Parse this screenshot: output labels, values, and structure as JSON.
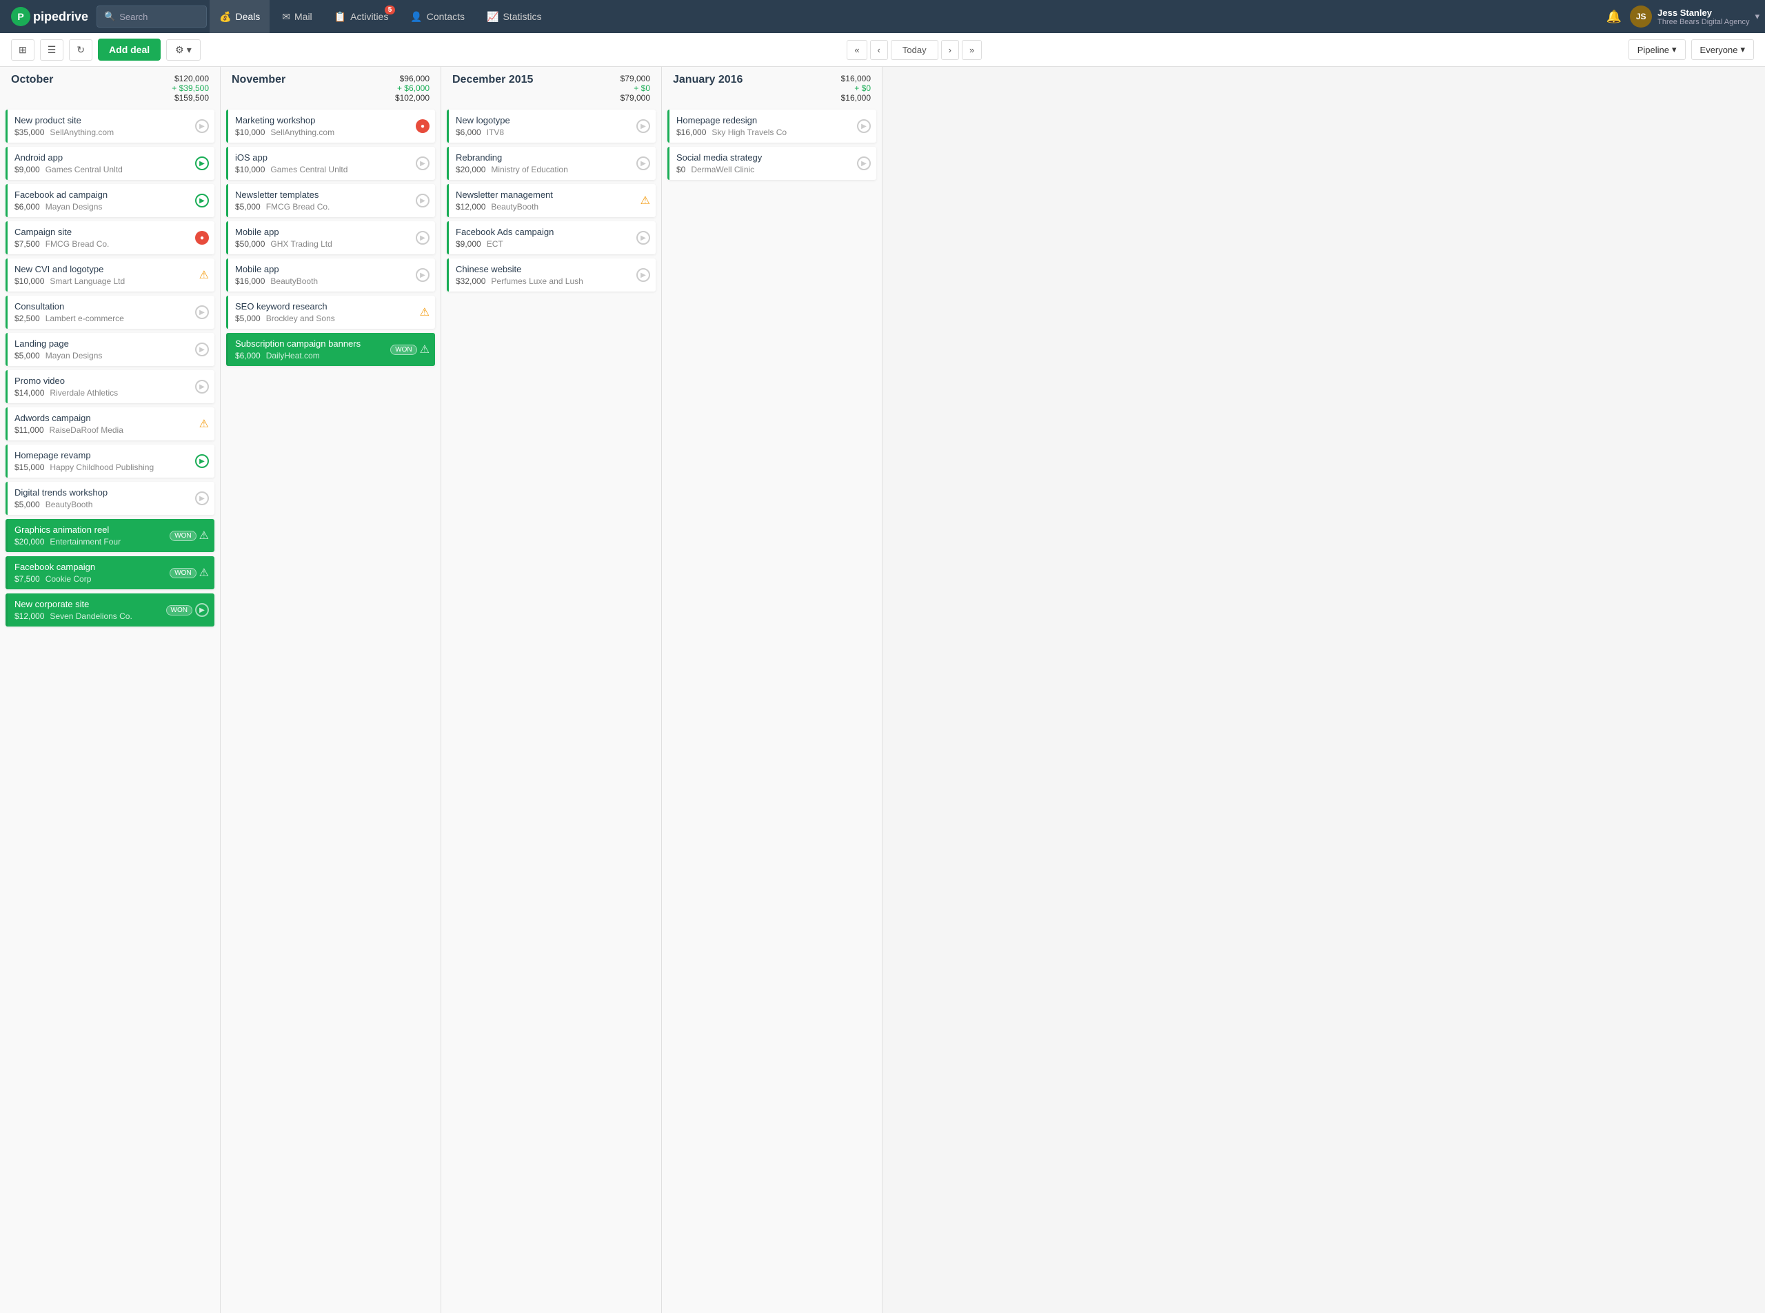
{
  "app": {
    "logo_text": "pipedrive"
  },
  "nav": {
    "search_placeholder": "Search",
    "items": [
      {
        "label": "Deals",
        "icon": "$",
        "active": true
      },
      {
        "label": "Mail",
        "icon": "✉"
      },
      {
        "label": "Activities",
        "icon": "📋",
        "badge": "5"
      },
      {
        "label": "Contacts",
        "icon": "👤"
      },
      {
        "label": "Statistics",
        "icon": "📈"
      }
    ],
    "bell_icon": "🔔",
    "user": {
      "name": "Jess Stanley",
      "company": "Three Bears Digital Agency",
      "avatar_initials": "JS"
    }
  },
  "toolbar": {
    "view_kanban": "⊞",
    "view_list": "☰",
    "refresh": "↻",
    "add_deal": "Add deal",
    "gear": "⚙",
    "arrow_first": "«",
    "arrow_prev": "‹",
    "today": "Today",
    "arrow_next": "›",
    "arrow_last": "»",
    "pipeline": "Pipeline",
    "everyone": "Everyone"
  },
  "columns": [
    {
      "id": "october",
      "title": "October",
      "amount_main": "$120,000",
      "amount_green": "+ $39,500",
      "amount_total": "$159,500",
      "deals": [
        {
          "title": "New product site",
          "amount": "$35,000",
          "org": "SellAnything.com",
          "icon": "gray-arrow"
        },
        {
          "title": "Android app",
          "amount": "$9,000",
          "org": "Games Central Unltd",
          "icon": "green-arrow"
        },
        {
          "title": "Facebook ad campaign",
          "amount": "$6,000",
          "org": "Mayan Designs",
          "icon": "green-arrow"
        },
        {
          "title": "Campaign site",
          "amount": "$7,500",
          "org": "FMCG Bread Co.",
          "icon": "red-circle"
        },
        {
          "title": "New CVI and logotype",
          "amount": "$10,000",
          "org": "Smart Language Ltd",
          "icon": "warn"
        },
        {
          "title": "Consultation",
          "amount": "$2,500",
          "org": "Lambert e-commerce",
          "icon": "gray-arrow"
        },
        {
          "title": "Landing page",
          "amount": "$5,000",
          "org": "Mayan Designs",
          "icon": "gray-arrow"
        },
        {
          "title": "Promo video",
          "amount": "$14,000",
          "org": "Riverdale Athletics",
          "icon": "gray-arrow"
        },
        {
          "title": "Adwords campaign",
          "amount": "$11,000",
          "org": "RaiseDaRoof Media",
          "icon": "warn"
        },
        {
          "title": "Homepage revamp",
          "amount": "$15,000",
          "org": "Happy Childhood Publishing",
          "icon": "green-arrow"
        },
        {
          "title": "Digital trends workshop",
          "amount": "$5,000",
          "org": "BeautyBooth",
          "icon": "gray-arrow"
        },
        {
          "title": "Graphics animation reel",
          "amount": "$20,000",
          "org": "Entertainment Four",
          "icon": "won-warn",
          "won": true
        },
        {
          "title": "Facebook campaign",
          "amount": "$7,500",
          "org": "Cookie Corp",
          "icon": "won-warn",
          "won": true
        },
        {
          "title": "New corporate site",
          "amount": "$12,000",
          "org": "Seven Dandelions Co.",
          "icon": "won-green",
          "won": true
        }
      ]
    },
    {
      "id": "november",
      "title": "November",
      "amount_main": "$96,000",
      "amount_green": "+ $6,000",
      "amount_total": "$102,000",
      "deals": [
        {
          "title": "Marketing workshop",
          "amount": "$10,000",
          "org": "SellAnything.com",
          "icon": "red-circle"
        },
        {
          "title": "iOS app",
          "amount": "$10,000",
          "org": "Games Central Unltd",
          "icon": "gray-arrow"
        },
        {
          "title": "Newsletter templates",
          "amount": "$5,000",
          "org": "FMCG Bread Co.",
          "icon": "gray-arrow"
        },
        {
          "title": "Mobile app",
          "amount": "$50,000",
          "org": "GHX Trading Ltd",
          "icon": "gray-arrow"
        },
        {
          "title": "Mobile app",
          "amount": "$16,000",
          "org": "BeautyBooth",
          "icon": "gray-arrow"
        },
        {
          "title": "SEO keyword research",
          "amount": "$5,000",
          "org": "Brockley and Sons",
          "icon": "warn"
        },
        {
          "title": "Subscription campaign banners",
          "amount": "$6,000",
          "org": "DailyHeat.com",
          "icon": "won-warn",
          "won": true
        }
      ]
    },
    {
      "id": "december",
      "title": "December 2015",
      "amount_main": "$79,000",
      "amount_green": "+ $0",
      "amount_total": "$79,000",
      "deals": [
        {
          "title": "New logotype",
          "amount": "$6,000",
          "org": "ITV8",
          "icon": "gray-arrow"
        },
        {
          "title": "Rebranding",
          "amount": "$20,000",
          "org": "Ministry of Education",
          "icon": "gray-arrow"
        },
        {
          "title": "Newsletter management",
          "amount": "$12,000",
          "org": "BeautyBooth",
          "icon": "warn"
        },
        {
          "title": "Facebook Ads campaign",
          "amount": "$9,000",
          "org": "ECT",
          "icon": "gray-arrow"
        },
        {
          "title": "Chinese website",
          "amount": "$32,000",
          "org": "Perfumes Luxe and Lush",
          "icon": "gray-arrow"
        }
      ]
    },
    {
      "id": "january",
      "title": "January 2016",
      "amount_main": "$16,000",
      "amount_green": "+ $0",
      "amount_total": "$16,000",
      "deals": [
        {
          "title": "Homepage redesign",
          "amount": "$16,000",
          "org": "Sky High Travels Co",
          "icon": "gray-arrow"
        },
        {
          "title": "Social media strategy",
          "amount": "$0",
          "org": "DermaWell Clinic",
          "icon": "gray-arrow"
        }
      ]
    }
  ]
}
